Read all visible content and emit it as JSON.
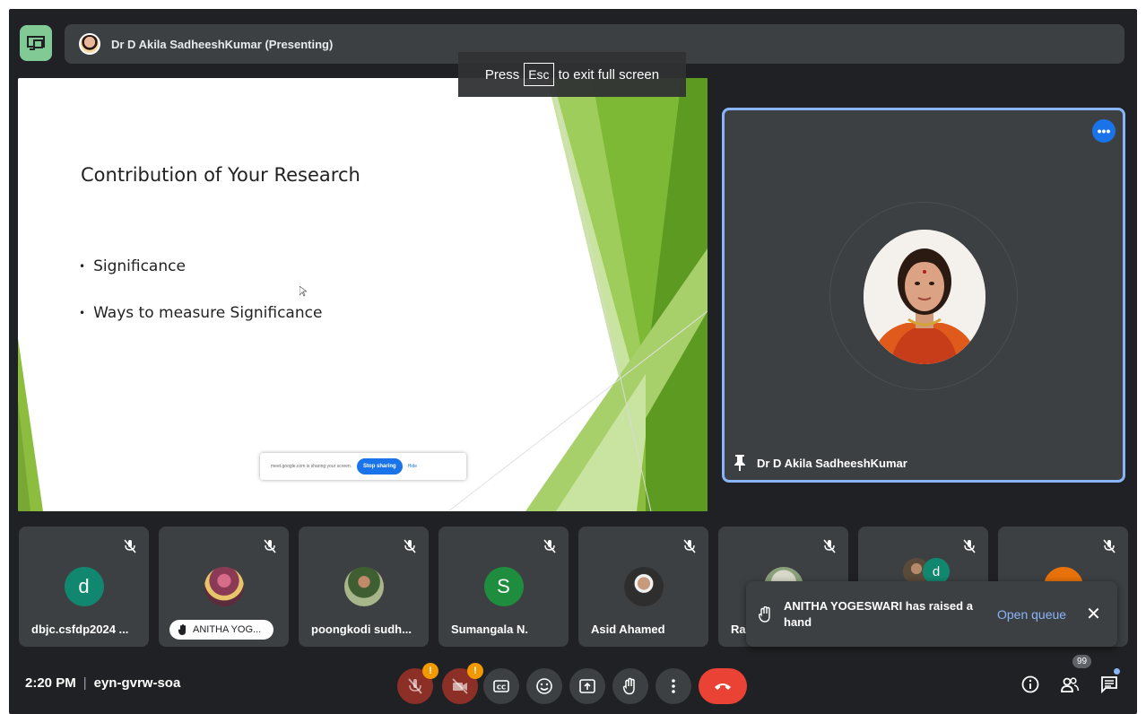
{
  "window": {
    "presenter_label": "Dr D Akila SadheeshKumar (Presenting)"
  },
  "fullscreen_tip": {
    "press": "Press",
    "key": "Esc",
    "rest": "to exit full screen"
  },
  "slide": {
    "title": "Contribution of Your Research",
    "bullets": [
      "Significance",
      "Ways to measure Significance"
    ],
    "share_bar": {
      "message": "meet.google.com is sharing your screen.",
      "stop_label": "Stop sharing",
      "hide_label": "Hide"
    }
  },
  "presenter_tile": {
    "name": "Dr D Akila SadheeshKumar",
    "more_icon": "more-horiz-icon",
    "pin_icon": "pin-icon"
  },
  "participants": [
    {
      "name": "dbjc.csfdp2024 ...",
      "initial": "d",
      "color": "#12876f",
      "muted": true
    },
    {
      "name": "ANITHA YOG...",
      "initial": "",
      "photo": true,
      "hand_raised": true,
      "muted": true
    },
    {
      "name": "poongkodi sudh...",
      "initial": "",
      "photo": true,
      "muted": true
    },
    {
      "name": "Sumangala N.",
      "initial": "S",
      "color": "#1e8e3e",
      "muted": true
    },
    {
      "name": "Asid Ahamed",
      "initial": "",
      "photo": true,
      "muted": true
    },
    {
      "name": "Ra",
      "initial": "",
      "photo": true,
      "muted": true
    },
    {
      "name": "",
      "initial": "d",
      "color": "#12876f",
      "photo": true,
      "muted": true
    },
    {
      "name": "",
      "initial": "",
      "color": "#e8710a",
      "muted": true
    }
  ],
  "raise_hand_toast": {
    "message": "ANITHA YOGESWARI has raised a hand",
    "action_label": "Open queue",
    "close_icon": "close-icon"
  },
  "bottom_bar": {
    "time": "2:20 PM",
    "separator": "|",
    "meeting_code": "eyn-gvrw-soa",
    "mic_badge": "!",
    "cam_badge": "!",
    "participant_count": "99",
    "controls": [
      "mic-off-icon",
      "camera-off-icon",
      "captions-icon",
      "emoji-icon",
      "present-icon",
      "raise-hand-icon",
      "more-vert-icon",
      "hang-up-icon"
    ],
    "side_icons": [
      "info-icon",
      "people-icon",
      "chat-icon"
    ]
  },
  "colors": {
    "background": "#202124",
    "tile": "#3c4043",
    "accent": "#8ab4f8",
    "hangup": "#ea4335",
    "badge": "#f29900",
    "present_button": "#81c995"
  }
}
